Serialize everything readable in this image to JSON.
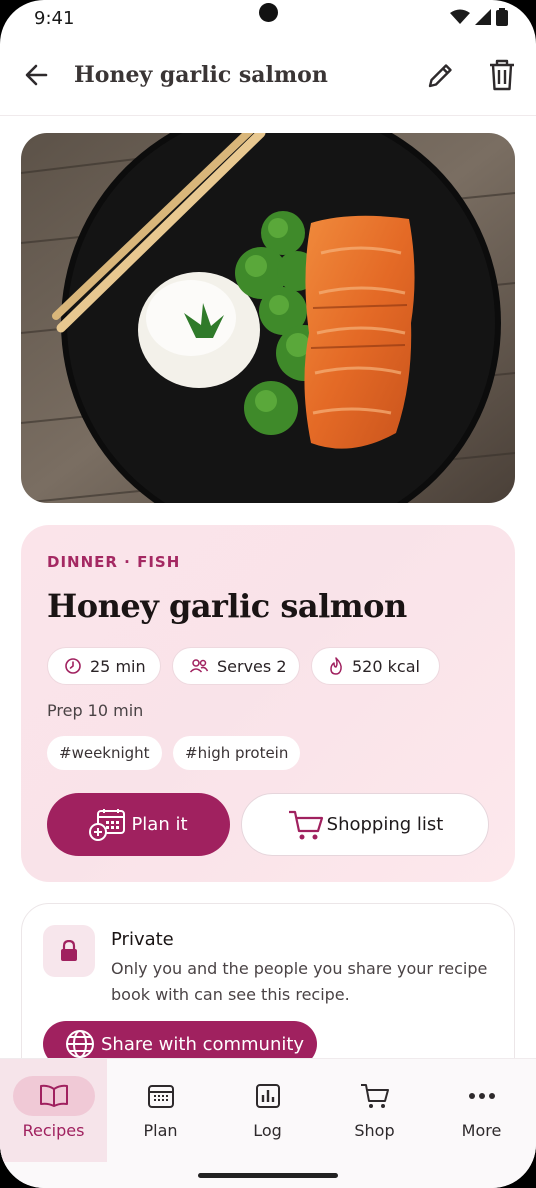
{
  "status_bar": {
    "time": "9:41"
  },
  "app_bar": {
    "title": "Honey garlic salmon"
  },
  "recipe": {
    "category": "DINNER · FISH",
    "title": "Honey garlic salmon",
    "chips": {
      "time": "25 min",
      "serves": "Serves 2",
      "calories": "520 kcal"
    },
    "prep": "Prep 10 min",
    "tags": [
      "#weeknight",
      "#high protein"
    ],
    "plan_label": "Plan it",
    "shopping_label": "Shopping list"
  },
  "privacy": {
    "title": "Private",
    "description": "Only you and the people you share your recipe book with can see this recipe.",
    "share_label": "Share with community"
  },
  "nav": {
    "items": [
      {
        "label": "Recipes",
        "icon": "book-icon",
        "active": true
      },
      {
        "label": "Plan",
        "icon": "calendar-icon",
        "active": false
      },
      {
        "label": "Log",
        "icon": "chart-icon",
        "active": false
      },
      {
        "label": "Shop",
        "icon": "cart-icon",
        "active": false
      },
      {
        "label": "More",
        "icon": "more-icon",
        "active": false
      }
    ]
  },
  "colors": {
    "accent": "#a0215f",
    "card_bg": "#fbe4ea"
  }
}
